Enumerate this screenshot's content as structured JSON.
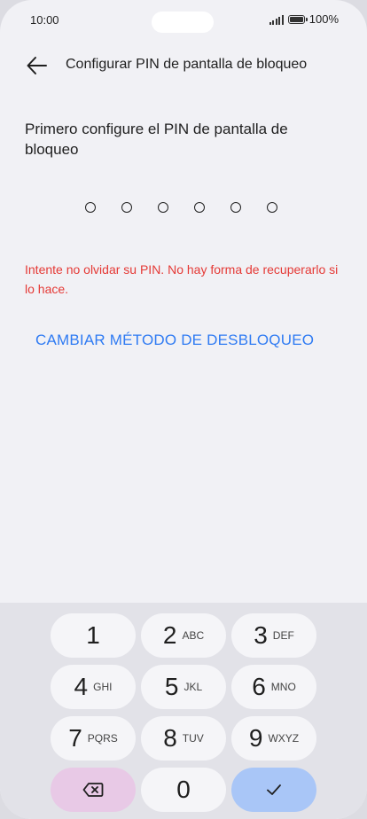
{
  "status_bar": {
    "time": "10:00",
    "battery_text": "100%"
  },
  "header": {
    "title": "Configurar PIN de pantalla de bloqueo"
  },
  "main": {
    "instruction": "Primero configure el PIN de pantalla de bloqueo",
    "pin_length": 6,
    "warning": "Intente no olvidar su PIN. No hay forma de recuperarlo si lo hace.",
    "change_method": "CAMBIAR MÉTODO DE DESBLOQUEO"
  },
  "keypad": {
    "keys": [
      {
        "num": "1",
        "letters": ""
      },
      {
        "num": "2",
        "letters": "ABC"
      },
      {
        "num": "3",
        "letters": "DEF"
      },
      {
        "num": "4",
        "letters": "GHI"
      },
      {
        "num": "5",
        "letters": "JKL"
      },
      {
        "num": "6",
        "letters": "MNO"
      },
      {
        "num": "7",
        "letters": "PQRS"
      },
      {
        "num": "8",
        "letters": "TUV"
      },
      {
        "num": "9",
        "letters": "WXYZ"
      },
      {
        "num": "0",
        "letters": ""
      }
    ],
    "delete_icon": "backspace-icon",
    "confirm_icon": "checkmark-icon"
  },
  "colors": {
    "warning": "#e53935",
    "link": "#2f7bf3",
    "delete_key": "#e8c9e6",
    "confirm_key": "#a9c6f7"
  }
}
